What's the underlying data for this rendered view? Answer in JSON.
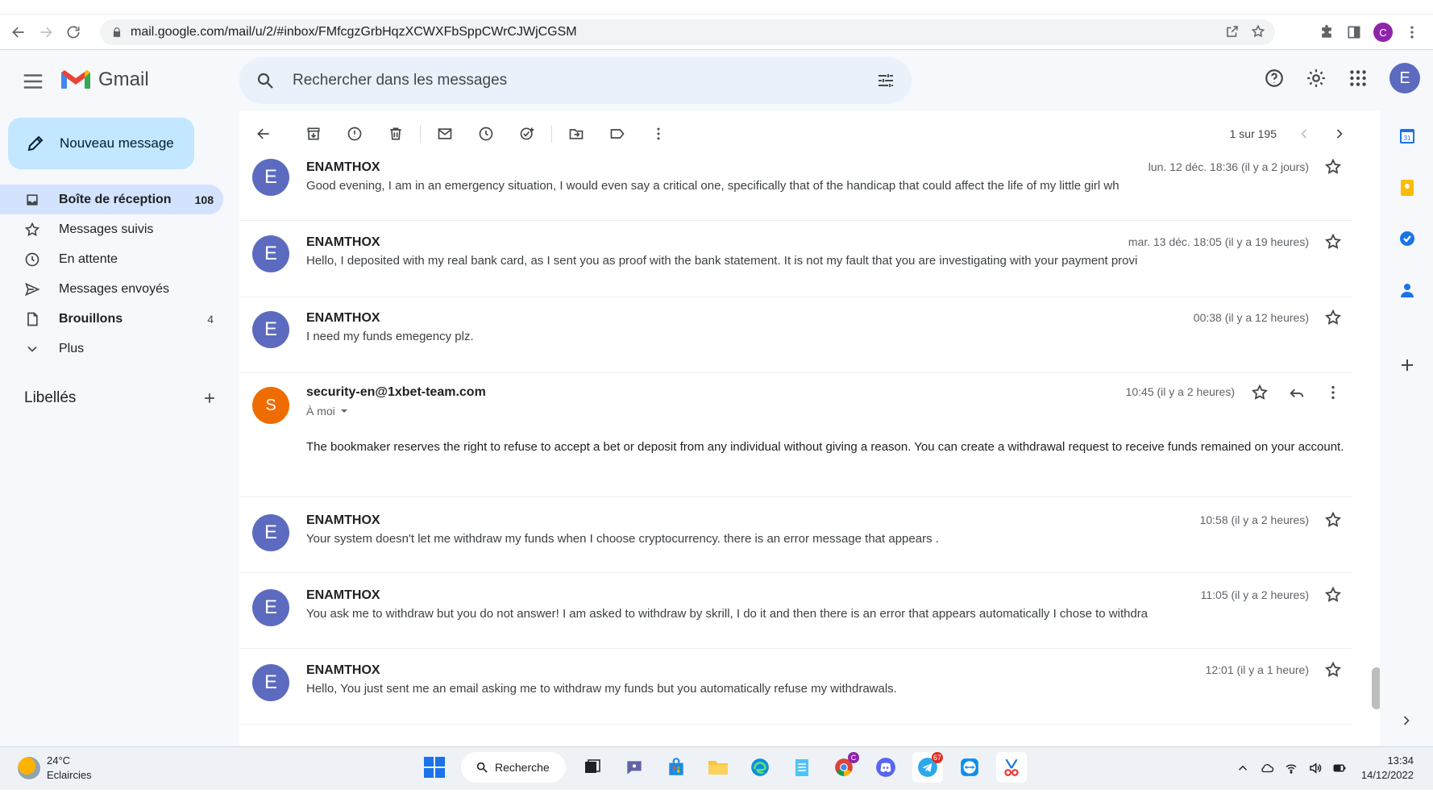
{
  "browser": {
    "url": "mail.google.com/mail/u/2/#inbox/FMfcgzGrbHqzXCWXFbSppCWrCJWjCGSM",
    "profile_initial": "C"
  },
  "gmail": {
    "app_name": "Gmail",
    "search_placeholder": "Rechercher dans les messages",
    "account_initial": "E"
  },
  "sidebar": {
    "compose_label": "Nouveau message",
    "items": [
      {
        "label": "Boîte de réception",
        "count": "108",
        "icon": "inbox-icon",
        "active": true
      },
      {
        "label": "Messages suivis",
        "count": "",
        "icon": "star-icon"
      },
      {
        "label": "En attente",
        "count": "",
        "icon": "clock-icon"
      },
      {
        "label": "Messages envoyés",
        "count": "",
        "icon": "send-icon"
      },
      {
        "label": "Brouillons",
        "count": "4",
        "icon": "draft-icon"
      },
      {
        "label": "Plus",
        "count": "",
        "icon": "chevron-down-icon"
      }
    ],
    "labels_title": "Libellés"
  },
  "toolbar": {
    "pager_text": "1 sur 195"
  },
  "messages": [
    {
      "sender": "ENAMTHOX",
      "initial": "E",
      "date": "lun. 12 déc. 18:36 (il y a 2 jours)",
      "snippet": "Good evening, I am in an emergency situation, I would even say a critical one, specifically that of the handicap that could affect the life of my little girl wh"
    },
    {
      "sender": "ENAMTHOX",
      "initial": "E",
      "date": "mar. 13 déc. 18:05 (il y a 19 heures)",
      "snippet": "Hello, I deposited with my real bank card, as I sent you as proof with the bank statement. It is not my fault that you are investigating with your payment provi"
    },
    {
      "sender": "ENAMTHOX",
      "initial": "E",
      "date": "00:38 (il y a 12 heures)",
      "snippet": "I need my funds emegency plz."
    },
    {
      "sender": "security-en@1xbet-team.com",
      "initial": "S",
      "date": "10:45 (il y a 2 heures)",
      "to": "À moi",
      "body": "The bookmaker reserves the right to refuse to accept a bet or deposit from any individual without giving a reason. You can create a withdrawal request to receive funds remained on your account."
    },
    {
      "sender": "ENAMTHOX",
      "initial": "E",
      "date": "10:58 (il y a 2 heures)",
      "snippet": "Your system doesn't let me withdraw my funds when I choose cryptocurrency. there is an error message that appears ."
    },
    {
      "sender": "ENAMTHOX",
      "initial": "E",
      "date": "11:05 (il y a 2 heures)",
      "snippet": "You ask me to withdraw but you do not answer! I am asked to withdraw by skrill, I do it and then there is an error that appears automatically I chose to withdra"
    },
    {
      "sender": "ENAMTHOX",
      "initial": "E",
      "date": "12:01 (il y a 1 heure)",
      "snippet": "Hello, You just sent me an email asking me to withdraw my funds but you automatically refuse my withdrawals."
    }
  ],
  "taskbar": {
    "temperature": "24°C",
    "weather": "Eclaircies",
    "search_label": "Recherche",
    "chrome_badge": "C",
    "telegram_badge": "67",
    "time": "13:34",
    "date": "14/12/2022"
  },
  "colors": {
    "accent": "#1a73e8",
    "avatar_e": "#5c6bc0",
    "avatar_s": "#ef6c00",
    "compose_bg": "#c2e7ff",
    "active_nav": "#d3e3fd"
  }
}
